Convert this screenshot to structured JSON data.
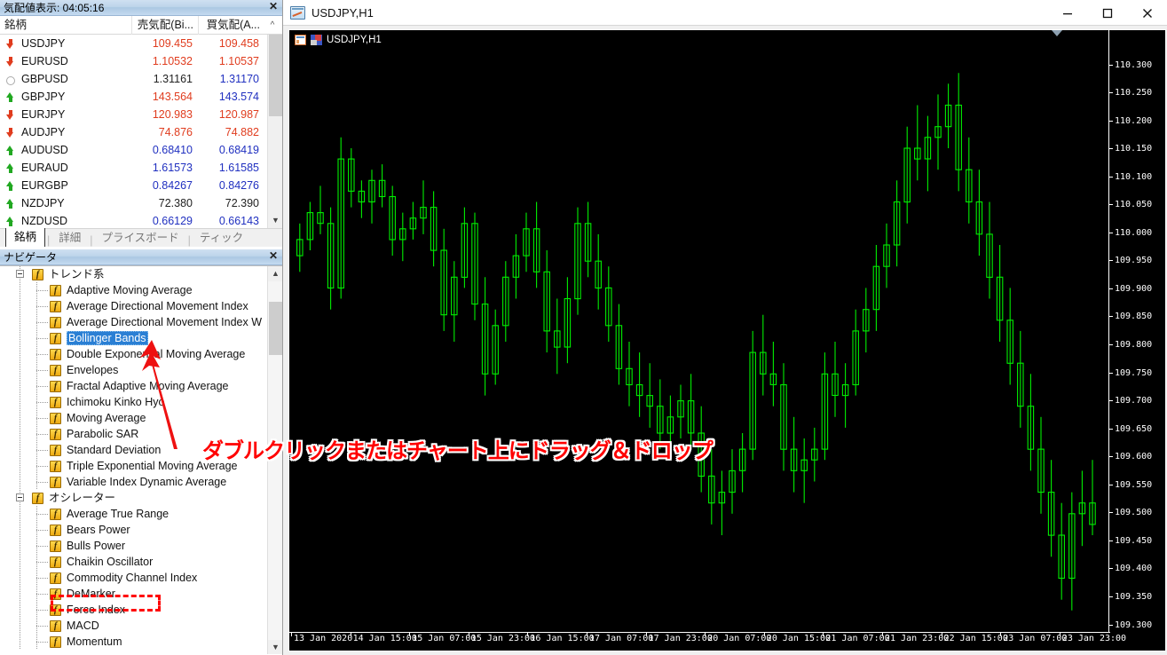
{
  "market_watch": {
    "title": "気配値表示: 04:05:16",
    "close_label": "✕",
    "columns": [
      "銘柄",
      "売気配(Bi...",
      "買気配(A...",
      "^"
    ],
    "rows": [
      {
        "symbol": "USDJPY",
        "dir": "down",
        "bid": "109.455",
        "bid_color": "#e03c1e",
        "ask": "109.458",
        "ask_color": "#e03c1e"
      },
      {
        "symbol": "EURUSD",
        "dir": "down",
        "bid": "1.10532",
        "bid_color": "#e03c1e",
        "ask": "1.10537",
        "ask_color": "#e03c1e"
      },
      {
        "symbol": "GBPUSD",
        "dir": "flat",
        "bid": "1.31161",
        "bid_color": "#222222",
        "ask": "1.31170",
        "ask_color": "#2030c0"
      },
      {
        "symbol": "GBPJPY",
        "dir": "up",
        "bid": "143.564",
        "bid_color": "#e03c1e",
        "ask": "143.574",
        "ask_color": "#2030c0"
      },
      {
        "symbol": "EURJPY",
        "dir": "down",
        "bid": "120.983",
        "bid_color": "#e03c1e",
        "ask": "120.987",
        "ask_color": "#e03c1e"
      },
      {
        "symbol": "AUDJPY",
        "dir": "down",
        "bid": "74.876",
        "bid_color": "#e03c1e",
        "ask": "74.882",
        "ask_color": "#e03c1e"
      },
      {
        "symbol": "AUDUSD",
        "dir": "up",
        "bid": "0.68410",
        "bid_color": "#2030c0",
        "ask": "0.68419",
        "ask_color": "#2030c0"
      },
      {
        "symbol": "EURAUD",
        "dir": "up",
        "bid": "1.61573",
        "bid_color": "#2030c0",
        "ask": "1.61585",
        "ask_color": "#2030c0"
      },
      {
        "symbol": "EURGBP",
        "dir": "up",
        "bid": "0.84267",
        "bid_color": "#2030c0",
        "ask": "0.84276",
        "ask_color": "#2030c0"
      },
      {
        "symbol": "NZDJPY",
        "dir": "up",
        "bid": "72.380",
        "bid_color": "#222222",
        "ask": "72.390",
        "ask_color": "#222222"
      },
      {
        "symbol": "NZDUSD",
        "dir": "up",
        "bid": "0.66129",
        "bid_color": "#2030c0",
        "ask": "0.66143",
        "ask_color": "#2030c0"
      }
    ],
    "tabs": [
      {
        "label": "銘柄",
        "active": true
      },
      {
        "label": "詳細",
        "active": false
      },
      {
        "label": "プライスボード",
        "active": false
      },
      {
        "label": "ティック",
        "active": false
      }
    ]
  },
  "navigator": {
    "title": "ナビゲータ",
    "close_label": "✕",
    "selected": "Bollinger Bands",
    "tree": [
      {
        "label": "トレンド系",
        "depth": 0,
        "group": true
      },
      {
        "label": "Adaptive Moving Average",
        "depth": 1,
        "group": false
      },
      {
        "label": "Average Directional Movement Index",
        "depth": 1,
        "group": false
      },
      {
        "label": "Average Directional Movement Index W",
        "depth": 1,
        "group": false
      },
      {
        "label": "Bollinger Bands",
        "depth": 1,
        "group": false,
        "selected": true
      },
      {
        "label": "Double Exponential Moving Average",
        "depth": 1,
        "group": false
      },
      {
        "label": "Envelopes",
        "depth": 1,
        "group": false
      },
      {
        "label": "Fractal Adaptive Moving Average",
        "depth": 1,
        "group": false
      },
      {
        "label": "Ichimoku Kinko Hyo",
        "depth": 1,
        "group": false
      },
      {
        "label": "Moving Average",
        "depth": 1,
        "group": false
      },
      {
        "label": "Parabolic SAR",
        "depth": 1,
        "group": false
      },
      {
        "label": "Standard Deviation",
        "depth": 1,
        "group": false
      },
      {
        "label": "Triple Exponential Moving Average",
        "depth": 1,
        "group": false
      },
      {
        "label": "Variable Index Dynamic Average",
        "depth": 1,
        "group": false
      },
      {
        "label": "オシレーター",
        "depth": 0,
        "group": true
      },
      {
        "label": "Average True Range",
        "depth": 1,
        "group": false
      },
      {
        "label": "Bears Power",
        "depth": 1,
        "group": false
      },
      {
        "label": "Bulls Power",
        "depth": 1,
        "group": false
      },
      {
        "label": "Chaikin Oscillator",
        "depth": 1,
        "group": false
      },
      {
        "label": "Commodity Channel Index",
        "depth": 1,
        "group": false
      },
      {
        "label": "DeMarker",
        "depth": 1,
        "group": false
      },
      {
        "label": "Force Index",
        "depth": 1,
        "group": false
      },
      {
        "label": "MACD",
        "depth": 1,
        "group": false
      },
      {
        "label": "Momentum",
        "depth": 1,
        "group": false
      }
    ]
  },
  "chart_window": {
    "title": "USDJPY,H1",
    "chart_label": "USDJPY,H1",
    "minimize": "–",
    "maximize": "□",
    "close": "✕"
  },
  "annotation": {
    "text": "ダブルクリックまたはチャート上にドラッグ＆ドロップ",
    "color": "#ff0000"
  },
  "chart_data": {
    "type": "candlestick",
    "title": "USDJPY,H1",
    "symbol": "USDJPY",
    "timeframe": "H1",
    "xlabel": "",
    "ylabel": "",
    "grid": false,
    "background": "#000000",
    "candle_color": "#00ee00",
    "ylim": [
      109.27,
      110.33
    ],
    "y_ticks": [
      "110.300",
      "110.250",
      "110.200",
      "110.150",
      "110.100",
      "110.050",
      "110.000",
      "109.950",
      "109.900",
      "109.850",
      "109.800",
      "109.750",
      "109.700",
      "109.650",
      "109.600",
      "109.550",
      "109.500",
      "109.450",
      "109.400",
      "109.350",
      "109.300"
    ],
    "x_ticks": [
      "13 Jan 2020",
      "14 Jan 15:00",
      "15 Jan 07:00",
      "15 Jan 23:00",
      "16 Jan 15:00",
      "17 Jan 07:00",
      "17 Jan 23:00",
      "20 Jan 07:00",
      "20 Jan 15:00",
      "21 Jan 07:00",
      "21 Jan 23:00",
      "22 Jan 15:00",
      "23 Jan 07:00",
      "23 Jan 23:00"
    ],
    "ohlc": [
      [
        109.96,
        110.02,
        109.93,
        109.99
      ],
      [
        109.99,
        110.06,
        109.97,
        110.04
      ],
      [
        110.04,
        110.09,
        110.0,
        110.02
      ],
      [
        110.02,
        110.05,
        109.86,
        109.9
      ],
      [
        109.9,
        110.18,
        109.88,
        110.14
      ],
      [
        110.14,
        110.16,
        110.05,
        110.08
      ],
      [
        110.08,
        110.1,
        110.03,
        110.06
      ],
      [
        110.06,
        110.12,
        110.02,
        110.1
      ],
      [
        110.1,
        110.13,
        110.05,
        110.07
      ],
      [
        110.07,
        110.09,
        109.96,
        109.99
      ],
      [
        109.99,
        110.04,
        109.95,
        110.01
      ],
      [
        110.01,
        110.06,
        109.99,
        110.03
      ],
      [
        110.03,
        110.1,
        110.0,
        110.05
      ],
      [
        110.05,
        110.08,
        109.94,
        109.97
      ],
      [
        109.97,
        110.01,
        109.82,
        109.85
      ],
      [
        109.85,
        109.95,
        109.8,
        109.92
      ],
      [
        109.92,
        110.05,
        109.9,
        110.02
      ],
      [
        110.02,
        110.04,
        109.84,
        109.87
      ],
      [
        109.87,
        109.92,
        109.7,
        109.74
      ],
      [
        109.74,
        109.86,
        109.72,
        109.83
      ],
      [
        109.83,
        109.95,
        109.8,
        109.92
      ],
      [
        109.92,
        110.0,
        109.88,
        109.96
      ],
      [
        109.96,
        110.04,
        109.93,
        110.01
      ],
      [
        110.01,
        110.06,
        109.9,
        109.93
      ],
      [
        109.93,
        109.97,
        109.78,
        109.82
      ],
      [
        109.82,
        109.88,
        109.74,
        109.79
      ],
      [
        109.79,
        109.92,
        109.76,
        109.88
      ],
      [
        109.88,
        110.05,
        109.85,
        110.02
      ],
      [
        110.02,
        110.06,
        109.92,
        109.95
      ],
      [
        109.95,
        110.0,
        109.86,
        109.9
      ],
      [
        109.9,
        109.94,
        109.8,
        109.83
      ],
      [
        109.83,
        109.87,
        109.72,
        109.75
      ],
      [
        109.75,
        109.8,
        109.68,
        109.72
      ],
      [
        109.72,
        109.78,
        109.66,
        109.7
      ],
      [
        109.7,
        109.76,
        109.64,
        109.68
      ],
      [
        109.68,
        109.73,
        109.6,
        109.63
      ],
      [
        109.63,
        109.7,
        109.58,
        109.66
      ],
      [
        109.66,
        109.72,
        109.62,
        109.69
      ],
      [
        109.69,
        109.74,
        109.6,
        109.63
      ],
      [
        109.63,
        109.68,
        109.52,
        109.55
      ],
      [
        109.55,
        109.6,
        109.46,
        109.5
      ],
      [
        109.5,
        109.56,
        109.44,
        109.52
      ],
      [
        109.52,
        109.6,
        109.48,
        109.56
      ],
      [
        109.56,
        109.63,
        109.52,
        109.6
      ],
      [
        109.6,
        109.82,
        109.58,
        109.78
      ],
      [
        109.78,
        109.85,
        109.7,
        109.74
      ],
      [
        109.74,
        109.8,
        109.68,
        109.72
      ],
      [
        109.72,
        109.76,
        109.56,
        109.6
      ],
      [
        109.6,
        109.66,
        109.52,
        109.56
      ],
      [
        109.56,
        109.62,
        109.5,
        109.58
      ],
      [
        109.58,
        109.64,
        109.54,
        109.6
      ],
      [
        109.6,
        109.78,
        109.58,
        109.74
      ],
      [
        109.74,
        109.8,
        109.66,
        109.7
      ],
      [
        109.7,
        109.76,
        109.64,
        109.72
      ],
      [
        109.72,
        109.86,
        109.7,
        109.82
      ],
      [
        109.82,
        109.9,
        109.78,
        109.86
      ],
      [
        109.86,
        109.98,
        109.82,
        109.94
      ],
      [
        109.94,
        110.02,
        109.9,
        109.98
      ],
      [
        109.98,
        110.1,
        109.94,
        110.06
      ],
      [
        110.06,
        110.2,
        110.02,
        110.16
      ],
      [
        110.16,
        110.24,
        110.1,
        110.14
      ],
      [
        110.14,
        110.22,
        110.08,
        110.18
      ],
      [
        110.18,
        110.26,
        110.12,
        110.2
      ],
      [
        110.2,
        110.28,
        110.16,
        110.24
      ],
      [
        110.24,
        110.3,
        110.08,
        110.12
      ],
      [
        110.12,
        110.18,
        110.02,
        110.06
      ],
      [
        110.06,
        110.12,
        109.96,
        110.0
      ],
      [
        110.0,
        110.06,
        109.88,
        109.92
      ],
      [
        109.92,
        109.98,
        109.8,
        109.84
      ],
      [
        109.84,
        109.9,
        109.72,
        109.76
      ],
      [
        109.76,
        109.82,
        109.64,
        109.68
      ],
      [
        109.68,
        109.74,
        109.56,
        109.6
      ],
      [
        109.6,
        109.66,
        109.48,
        109.52
      ],
      [
        109.52,
        109.58,
        109.4,
        109.44
      ],
      [
        109.44,
        109.5,
        109.32,
        109.36
      ],
      [
        109.36,
        109.52,
        109.3,
        109.48
      ],
      [
        109.48,
        109.56,
        109.42,
        109.5
      ],
      [
        109.5,
        109.58,
        109.44,
        109.46
      ]
    ]
  }
}
